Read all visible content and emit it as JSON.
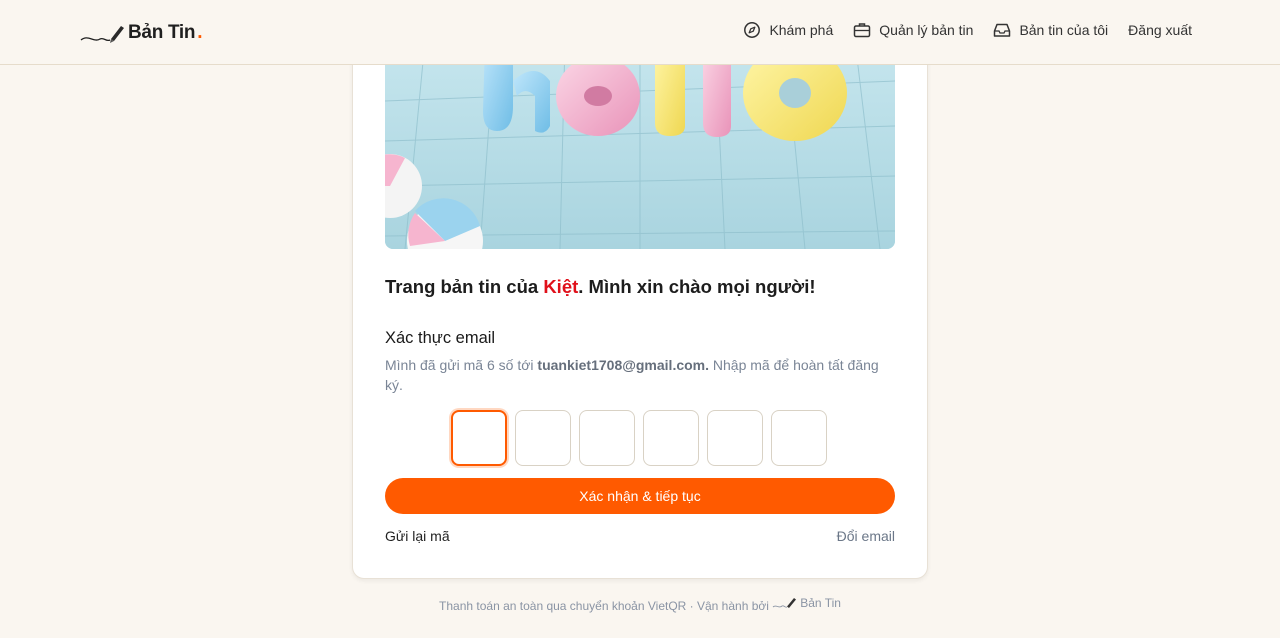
{
  "header": {
    "brand": "Bản Tin",
    "brand_dot": ".",
    "nav": [
      {
        "label": "Khám phá",
        "icon": "compass-icon"
      },
      {
        "label": "Quản lý bản tin",
        "icon": "briefcase-icon"
      },
      {
        "label": "Bản tin của tôi",
        "icon": "inbox-icon"
      },
      {
        "label": "Đăng xuất"
      }
    ]
  },
  "hero": {
    "alt_word": "hello"
  },
  "intro": {
    "prefix": "Trang bản tin của ",
    "name": "Kiệt",
    "suffix": ". Mình xin chào mọi người!"
  },
  "verify": {
    "title": "Xác thực email",
    "desc_prefix": "Mình đã gửi mã 6 số tới ",
    "email": "tuankiet1708@gmail.com.",
    "desc_suffix": " Nhập mã để hoàn tất đăng ký.",
    "otp_values": [
      "",
      "",
      "",
      "",
      "",
      ""
    ],
    "submit_label": "Xác nhận & tiếp tục",
    "resend_label": "Gửi lại mã",
    "change_email_label": "Đổi email"
  },
  "footer": {
    "text": "Thanh toán an toàn qua chuyển khoản VietQR · Vận hành bởi ",
    "brand": "Bản Tin"
  },
  "colors": {
    "accent": "#ff5a00",
    "name_red": "#e0101a",
    "background": "#faf6f0"
  }
}
